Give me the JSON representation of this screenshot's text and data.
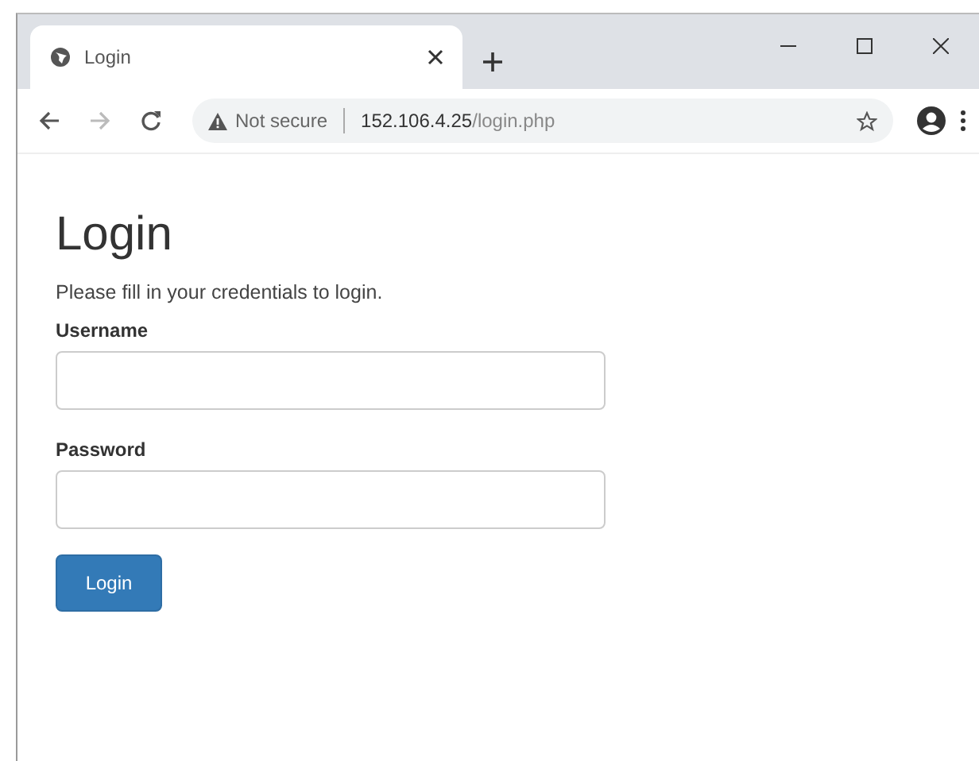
{
  "tab": {
    "title": "Login",
    "selected": true
  },
  "address_bar": {
    "security": "Not secure",
    "url_host": "152.106.4.25",
    "url_path": "/login.php"
  },
  "page": {
    "heading": "Login",
    "intro": "Please fill in your credentials to login.",
    "fields": [
      {
        "label": "Username"
      },
      {
        "label": "Password"
      }
    ],
    "submit": "Login"
  }
}
